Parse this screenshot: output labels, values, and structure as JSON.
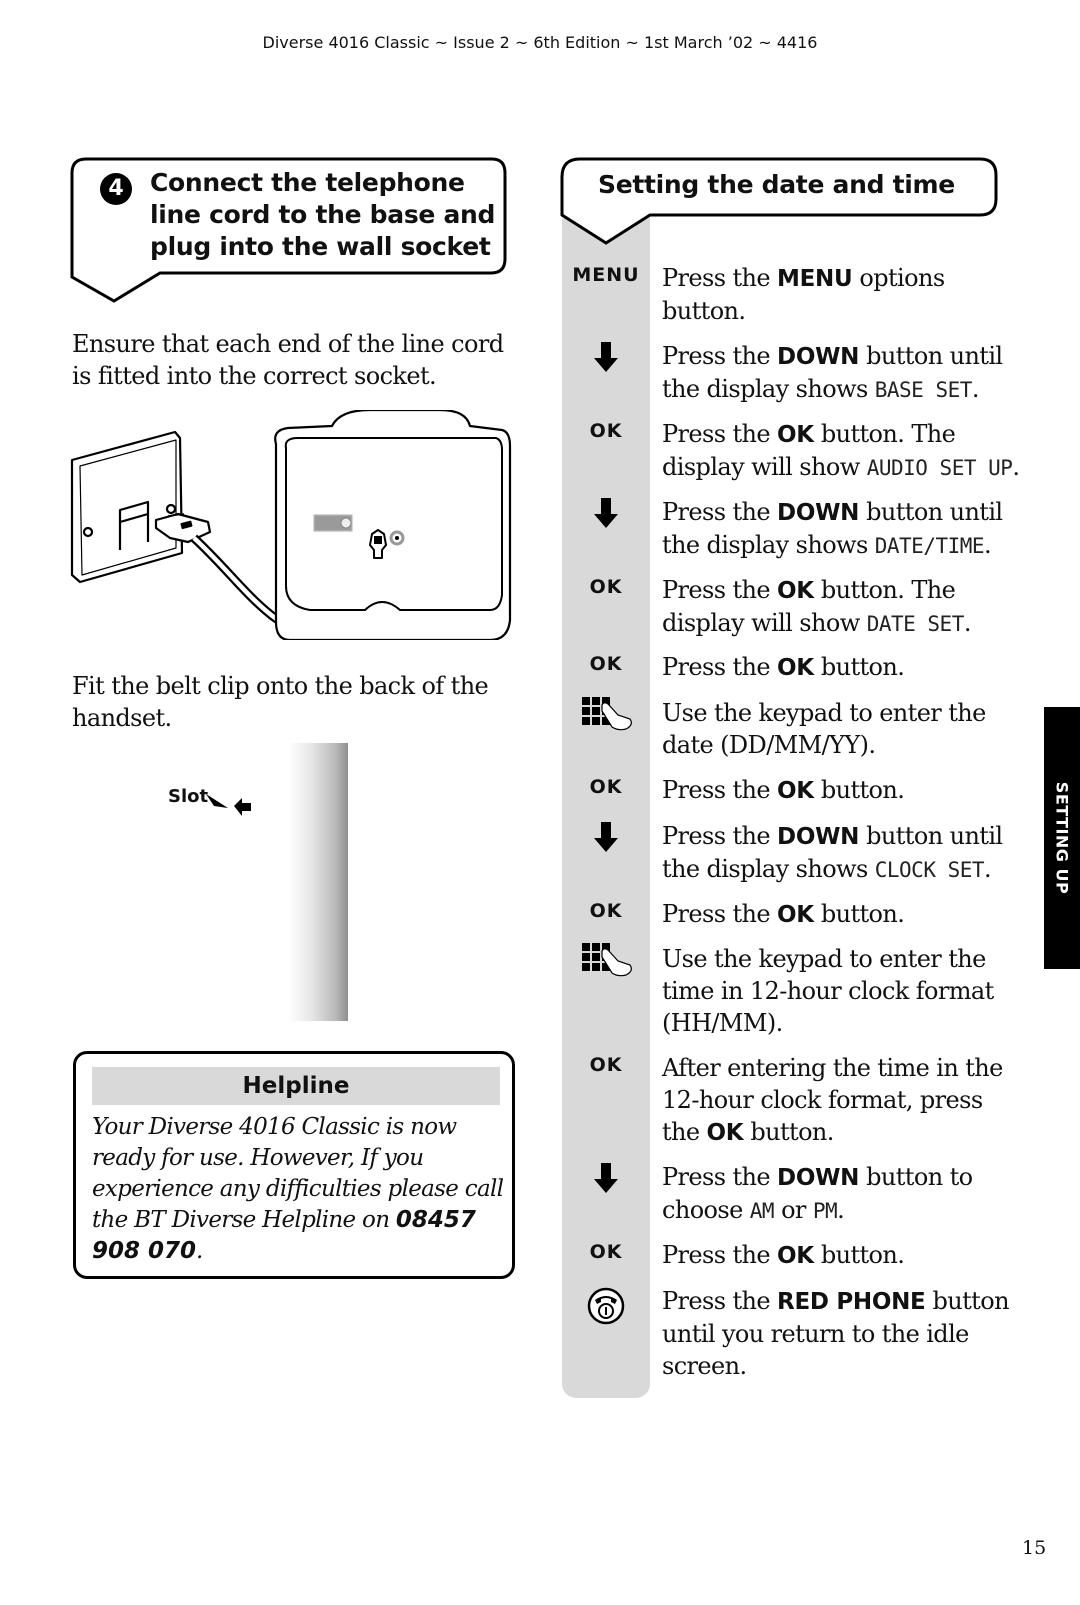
{
  "running_header": "Diverse 4016 Classic ~ Issue 2 ~ 6th Edition ~ 1st March ’02 ~ 4416",
  "left_column": {
    "step_number": "4",
    "step_title": "Connect the telephone line cord to the base and plug into the wall socket",
    "ensure_text": "Ensure that each end of the line cord is fitted into the correct socket.",
    "line_cord_illustration": "wall-socket-to-base-line-cord",
    "belt_clip_text": "Fit the belt clip onto the back of the handset.",
    "slot_label": "Slot",
    "helpline": {
      "title": "Helpline",
      "body": "Your Diverse 4016 Classic is now ready for use. However, If you experience any difficulties please call the BT Diverse Helpline on ",
      "phone": "08457 908 070",
      "trailing": "."
    }
  },
  "right_column": {
    "title": "Setting the date and time",
    "steps": [
      {
        "icon": "menu-key",
        "icon_label": "MENU",
        "parts": [
          [
            "t",
            "Press the "
          ],
          [
            "b",
            "MENU"
          ],
          [
            "t",
            " options button."
          ]
        ]
      },
      {
        "icon": "down-arrow-icon",
        "icon_label": "",
        "parts": [
          [
            "t",
            "Press the "
          ],
          [
            "b",
            "DOWN"
          ],
          [
            "t",
            " button until the display shows "
          ],
          [
            "l",
            "BASE SET"
          ],
          [
            "t",
            "."
          ]
        ]
      },
      {
        "icon": "ok-key",
        "icon_label": "OK",
        "parts": [
          [
            "t",
            "Press the "
          ],
          [
            "b",
            "OK"
          ],
          [
            "t",
            " button. The display will show "
          ],
          [
            "l",
            "AUDIO SET UP"
          ],
          [
            "t",
            "."
          ]
        ]
      },
      {
        "icon": "down-arrow-icon",
        "icon_label": "",
        "parts": [
          [
            "t",
            "Press the "
          ],
          [
            "b",
            "DOWN"
          ],
          [
            "t",
            " button until the display shows "
          ],
          [
            "l",
            "DATE/TIME"
          ],
          [
            "t",
            "."
          ]
        ]
      },
      {
        "icon": "ok-key",
        "icon_label": "OK",
        "parts": [
          [
            "t",
            "Press the "
          ],
          [
            "b",
            "OK"
          ],
          [
            "t",
            " button. The display will show "
          ],
          [
            "l",
            "DATE SET"
          ],
          [
            "t",
            "."
          ]
        ]
      },
      {
        "icon": "ok-key",
        "icon_label": "OK",
        "parts": [
          [
            "t",
            "Press the "
          ],
          [
            "b",
            "OK"
          ],
          [
            "t",
            " button."
          ]
        ]
      },
      {
        "icon": "keypad-icon",
        "icon_label": "",
        "parts": [
          [
            "t",
            "Use the keypad to enter the date (DD/MM/YY)."
          ]
        ]
      },
      {
        "icon": "ok-key",
        "icon_label": "OK",
        "parts": [
          [
            "t",
            "Press the "
          ],
          [
            "b",
            "OK"
          ],
          [
            "t",
            " button."
          ]
        ]
      },
      {
        "icon": "down-arrow-icon",
        "icon_label": "",
        "parts": [
          [
            "t",
            "Press the "
          ],
          [
            "b",
            "DOWN"
          ],
          [
            "t",
            " button until the display shows "
          ],
          [
            "l",
            "CLOCK SET"
          ],
          [
            "t",
            "."
          ]
        ]
      },
      {
        "icon": "ok-key",
        "icon_label": "OK",
        "parts": [
          [
            "t",
            "Press the "
          ],
          [
            "b",
            "OK"
          ],
          [
            "t",
            " button."
          ]
        ]
      },
      {
        "icon": "keypad-icon",
        "icon_label": "",
        "parts": [
          [
            "t",
            "Use the keypad to enter the time in 12-hour clock format (HH/MM)."
          ]
        ]
      },
      {
        "icon": "ok-key",
        "icon_label": "OK",
        "parts": [
          [
            "t",
            "After entering the time in the 12-hour clock format, press the "
          ],
          [
            "b",
            "OK"
          ],
          [
            "t",
            " button."
          ]
        ]
      },
      {
        "icon": "down-arrow-icon",
        "icon_label": "",
        "parts": [
          [
            "t",
            "Press the "
          ],
          [
            "b",
            "DOWN"
          ],
          [
            "t",
            " button to choose "
          ],
          [
            "l",
            "AM"
          ],
          [
            "t",
            " or "
          ],
          [
            "l",
            "PM"
          ],
          [
            "t",
            "."
          ]
        ]
      },
      {
        "icon": "ok-key",
        "icon_label": "OK",
        "parts": [
          [
            "t",
            "Press the "
          ],
          [
            "b",
            "OK"
          ],
          [
            "t",
            " button."
          ]
        ]
      },
      {
        "icon": "red-phone-icon",
        "icon_label": "",
        "parts": [
          [
            "t",
            "Press the "
          ],
          [
            "b",
            "RED PHONE"
          ],
          [
            "t",
            " button until you return to the idle screen."
          ]
        ]
      }
    ]
  },
  "side_tab": "SETTING UP",
  "page_number": "15"
}
